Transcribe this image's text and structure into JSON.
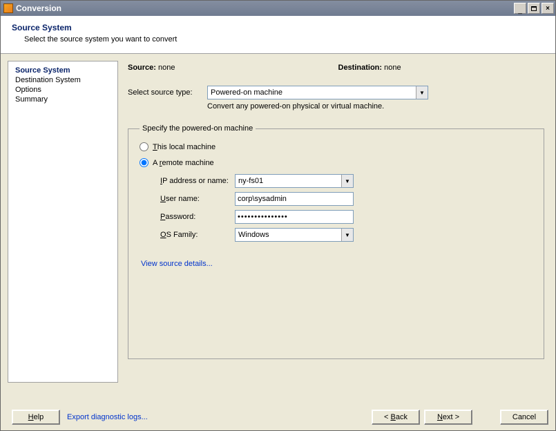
{
  "window": {
    "title": "Conversion"
  },
  "header": {
    "title": "Source System",
    "subtitle": "Select the source system you want to convert"
  },
  "sidebar": {
    "items": [
      {
        "label": "Source System",
        "active": true
      },
      {
        "label": "Destination System",
        "active": false
      },
      {
        "label": "Options",
        "active": false
      },
      {
        "label": "Summary",
        "active": false
      }
    ]
  },
  "main": {
    "source_label": "Source:",
    "source_value": "none",
    "destination_label": "Destination:",
    "destination_value": "none",
    "select_source_label": "Select source type:",
    "select_source_value": "Powered-on machine",
    "select_source_hint": "Convert any powered-on physical or virtual machine.",
    "group_legend": "Specify the powered-on machine",
    "radio_local": "This local machine",
    "radio_remote": "A remote machine",
    "ip_label": "IP address or name:",
    "ip_value": "ny-fs01",
    "user_label": "User name:",
    "user_value": "corp\\sysadmin",
    "pass_label": "Password:",
    "pass_value": "•••••••••••••••",
    "os_label": "OS Family:",
    "os_value": "Windows",
    "view_details": "View source details..."
  },
  "footer": {
    "help": "Help",
    "export": "Export diagnostic logs...",
    "back": "< Back",
    "next": "Next >",
    "cancel": "Cancel"
  }
}
